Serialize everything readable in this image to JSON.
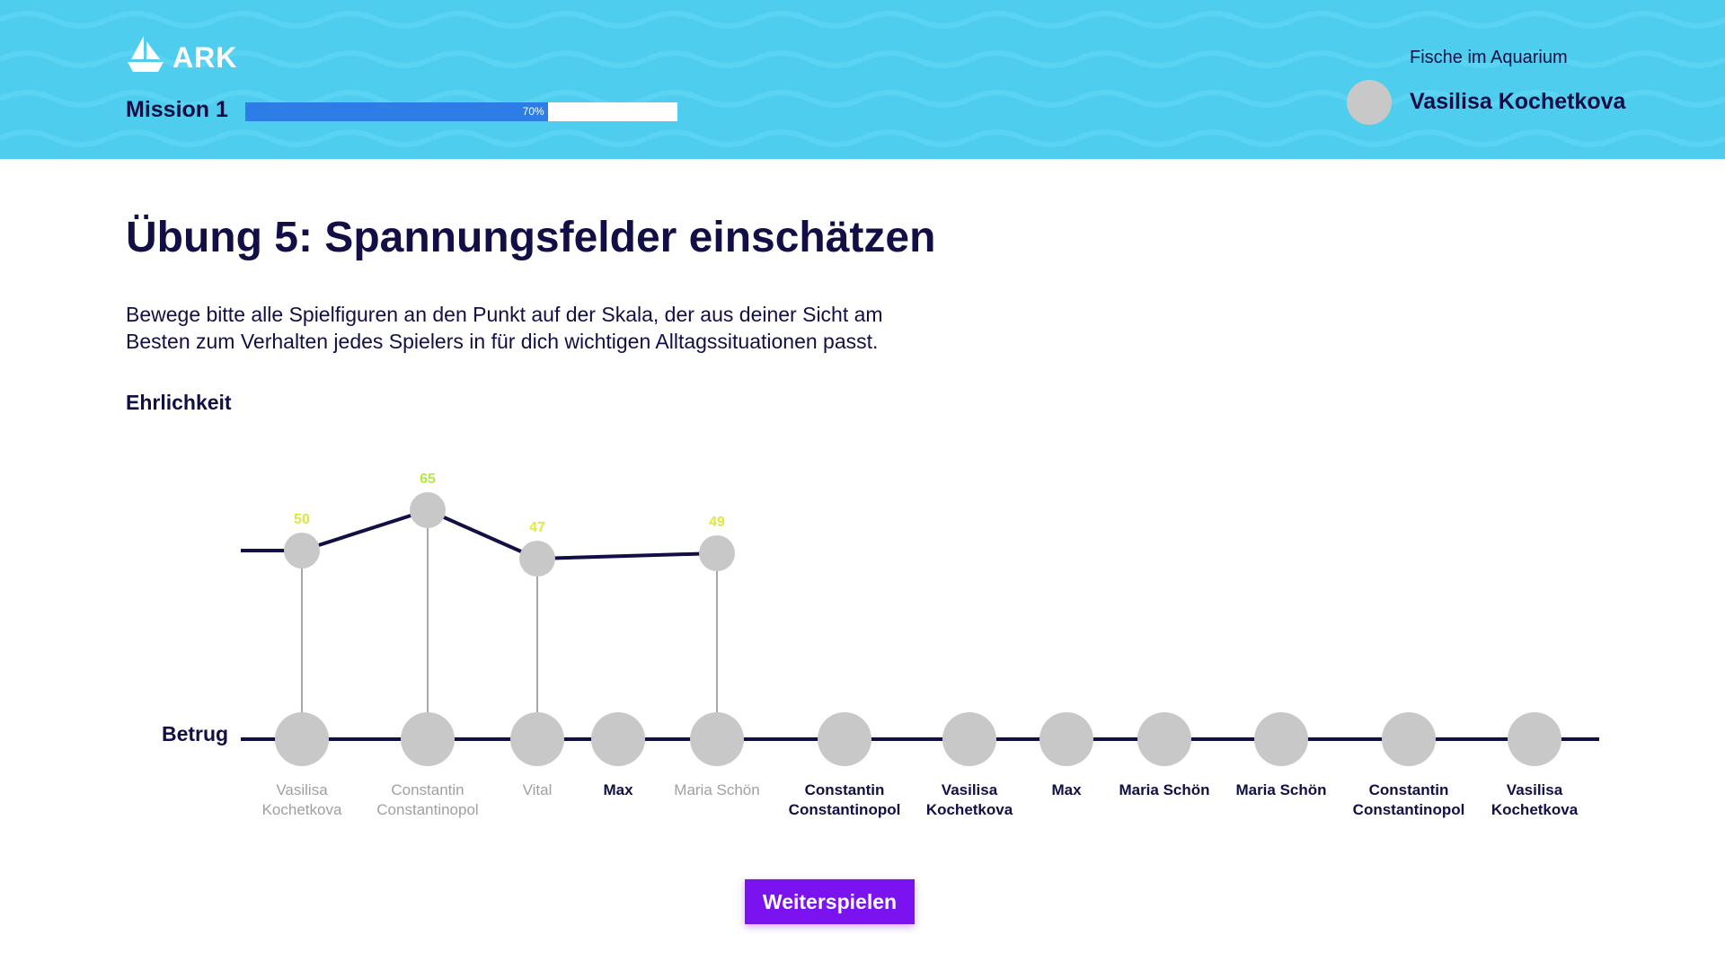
{
  "header": {
    "logo_text": "ARK",
    "mission_label": "Mission 1",
    "progress": {
      "value": 70,
      "label": "70%"
    },
    "user_caption": "Fische im Aquarium",
    "user_name": "Vasilisa Kochetkova"
  },
  "page": {
    "title": "Übung 5: Spannungsfelder einschätzen",
    "instructions": "Bewege bitte alle Spielfiguren an den Punkt auf der Skala, der aus deiner Sicht am Besten zum Verhalten jedes Spielers in für dich wichtigen Alltagssituationen passt.",
    "continue_label": "Weiterspielen"
  },
  "scale": {
    "top_label": "Ehrlichkeit",
    "bottom_label": "Betrug",
    "gradient_colors": [
      "#66dd44",
      "#e8e83c",
      "#e53a22"
    ]
  },
  "colors": {
    "line": "#120f47",
    "token": "#c8c8c8",
    "placed_name": "#a0a0a0",
    "unplaced_name": "#120f47"
  },
  "chart_data": {
    "type": "line",
    "y_range": [
      0,
      100
    ],
    "players": [
      {
        "name": [
          "Vasilisa",
          "Kochetkova"
        ],
        "value": 50
      },
      {
        "name": [
          "Constantin",
          "Constantinopol"
        ],
        "value": 65
      },
      {
        "name": [
          "Vital"
        ],
        "value": 47
      },
      {
        "name": [
          "Max"
        ],
        "value": null
      },
      {
        "name": [
          "Maria Schön"
        ],
        "value": 49
      },
      {
        "name": [
          "Constantin",
          "Constantinopol"
        ],
        "value": null
      },
      {
        "name": [
          "Vasilisa",
          "Kochetkova"
        ],
        "value": null
      },
      {
        "name": [
          "Max"
        ],
        "value": null
      },
      {
        "name": [
          "Maria Schön"
        ],
        "value": null
      },
      {
        "name": [
          "Maria Schön"
        ],
        "value": null
      },
      {
        "name": [
          "Constantin",
          "Constantinopol"
        ],
        "value": null
      },
      {
        "name": [
          "Vasilisa",
          "Kochetkova"
        ],
        "value": null
      }
    ]
  }
}
